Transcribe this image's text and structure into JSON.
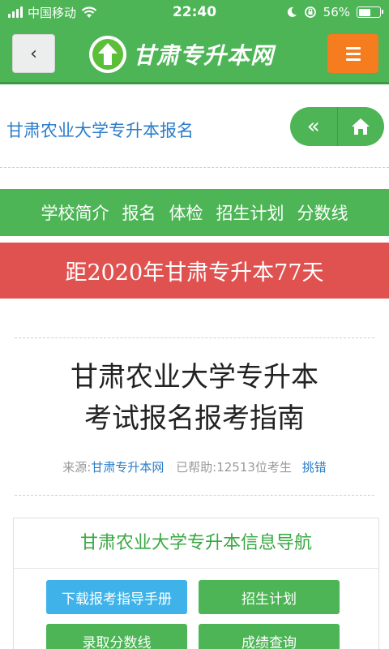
{
  "status_bar": {
    "carrier": "中国移动",
    "time": "22:40",
    "battery_percent": "56%",
    "battery_level": 0.56,
    "icons": [
      "signal-icon",
      "wifi-icon",
      "moon-icon",
      "rotation-lock-icon",
      "battery-icon"
    ]
  },
  "header": {
    "back_icon": "‹",
    "logo_text": "甘肃专升本网",
    "menu_icon": "hamburger-icon",
    "colors": {
      "bar": "#4db556",
      "menu_button": "#f57c1f"
    }
  },
  "subheader": {
    "title": "甘肃农业大学专升本报名",
    "prev_icon": "«",
    "home_icon": "home-icon"
  },
  "nav": {
    "items": [
      {
        "label": "学校简介"
      },
      {
        "label": "报名"
      },
      {
        "label": "体检"
      },
      {
        "label": "招生计划"
      },
      {
        "label": "分数线"
      }
    ]
  },
  "countdown": {
    "text": "距2020年甘肃专升本77天",
    "color": "#e05250"
  },
  "article": {
    "title_line1": "甘肃农业大学专升本",
    "title_line2": "考试报名报考指南",
    "source_label": "来源:",
    "source_link": "甘肃专升本网",
    "helped": "已帮助:12513位考生",
    "report_link": "挑错"
  },
  "info_nav": {
    "title": "甘肃农业大学专升本信息导航",
    "buttons": [
      {
        "label": "下载报考指导手册",
        "color": "#3fb3e9"
      },
      {
        "label": "招生计划",
        "color": "#4db556"
      },
      {
        "label": "录取分数线",
        "color": "#4db556"
      },
      {
        "label": "成绩查询",
        "color": "#4db556"
      }
    ]
  }
}
